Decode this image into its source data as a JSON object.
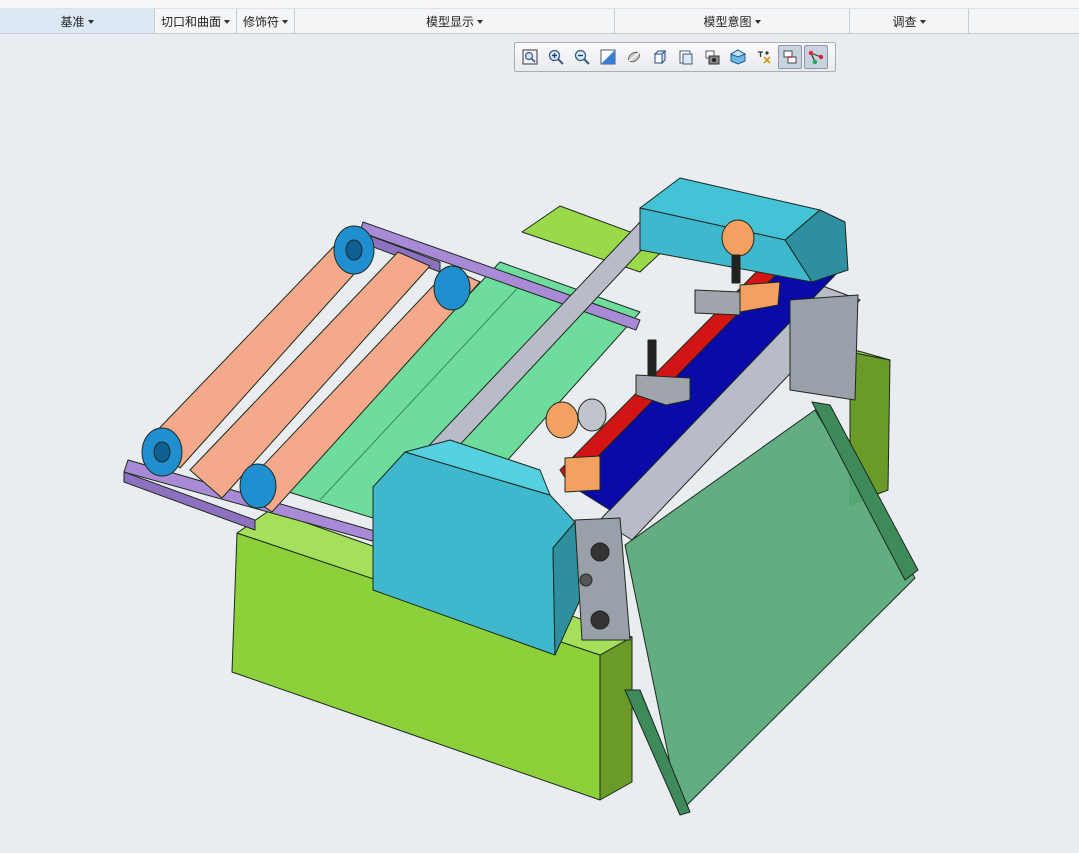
{
  "ribbon": {
    "groups": [
      {
        "label": "基准"
      },
      {
        "label": "切口和曲面"
      },
      {
        "label": "修饰符"
      },
      {
        "label": "模型显示"
      },
      {
        "label": "模型意图"
      },
      {
        "label": "调查"
      }
    ]
  },
  "view_toolbar": {
    "buttons": [
      {
        "icon": "refit-icon"
      },
      {
        "icon": "zoom-in-icon"
      },
      {
        "icon": "zoom-out-icon"
      },
      {
        "icon": "repaint-icon"
      },
      {
        "icon": "display-style-icon"
      },
      {
        "icon": "saved-orientations-icon"
      },
      {
        "icon": "view-manager-icon"
      },
      {
        "icon": "perspective-view-icon"
      },
      {
        "icon": "datum-display-icon"
      },
      {
        "icon": "annotation-display-icon"
      },
      {
        "icon": "spin-center-icon",
        "active": true
      },
      {
        "icon": "point-display-icon",
        "active": true
      }
    ]
  },
  "colors": {
    "lime": "#8cd13a",
    "cyan": "#3fb7cc",
    "navy": "#0a0aa8",
    "roller": "#f4a98a",
    "bearing": "#1f8fd0",
    "rail": "#a98ad6",
    "green_plate": "#56a878",
    "mint": "#6edc9c"
  }
}
